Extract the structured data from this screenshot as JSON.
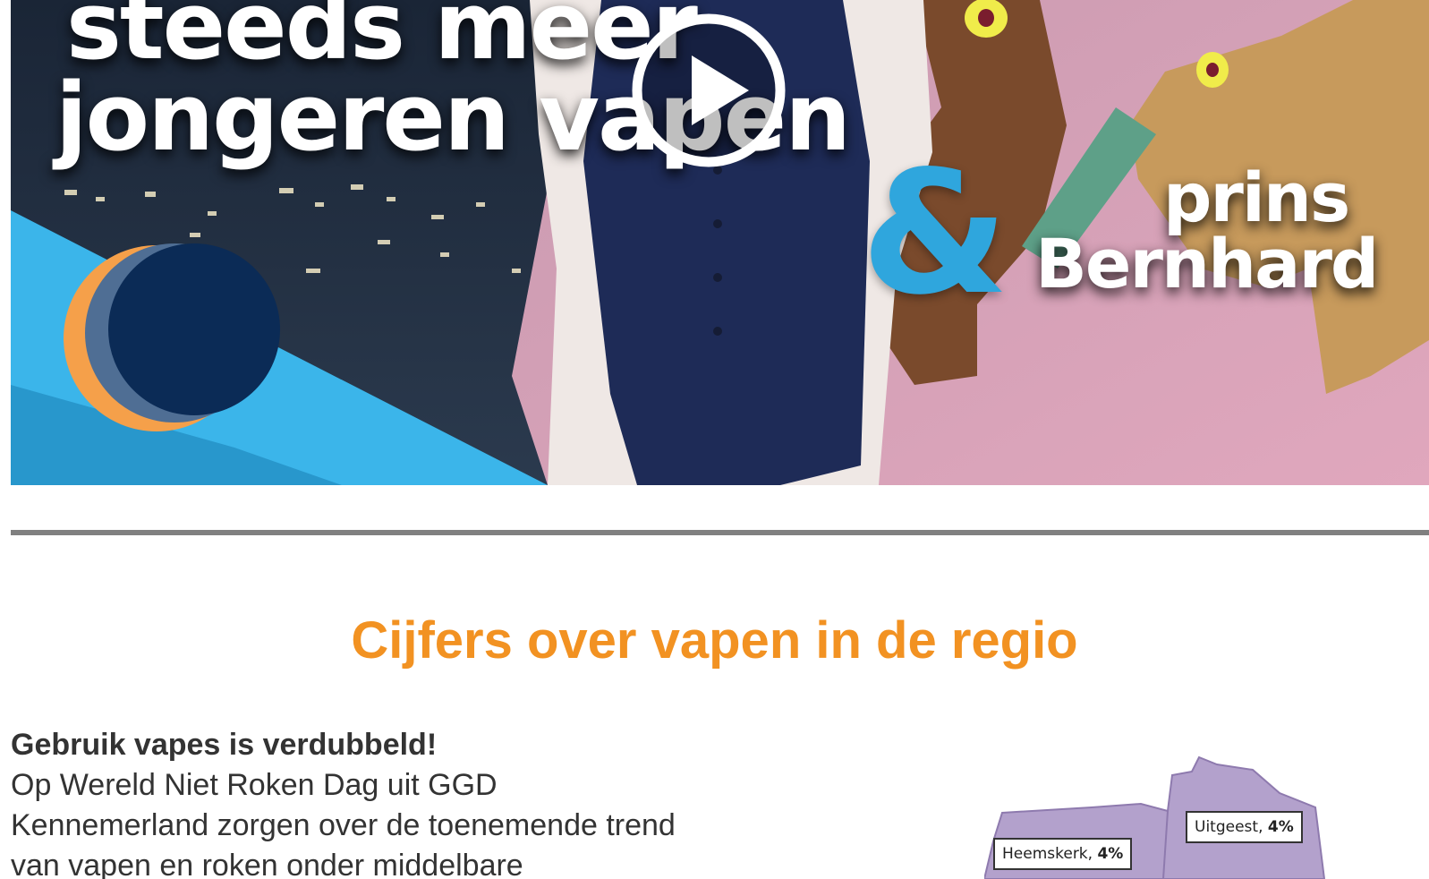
{
  "video": {
    "line1": "steeds meer",
    "line2": "jongeren vapen",
    "ampersand": "&",
    "line3": "prins",
    "line4": "Bernhard"
  },
  "section": {
    "title": "Cijfers over vapen in de regio"
  },
  "article": {
    "heading": "Gebruik vapes is verdubbeld!",
    "body": "Op Wereld Niet Roken Dag uit GGD Kennemerland zorgen over de toenemende trend van vapen en roken onder middelbare"
  },
  "map": {
    "labels": [
      {
        "name": "Uitgeest,",
        "value": "4%"
      },
      {
        "name": "Heemskerk,",
        "value": "4%"
      }
    ],
    "fill_color": "#b3a1cc"
  },
  "colors": {
    "accent": "#f29222",
    "divider": "#808080",
    "text": "#333333"
  },
  "icons": {
    "play": "play-icon"
  }
}
